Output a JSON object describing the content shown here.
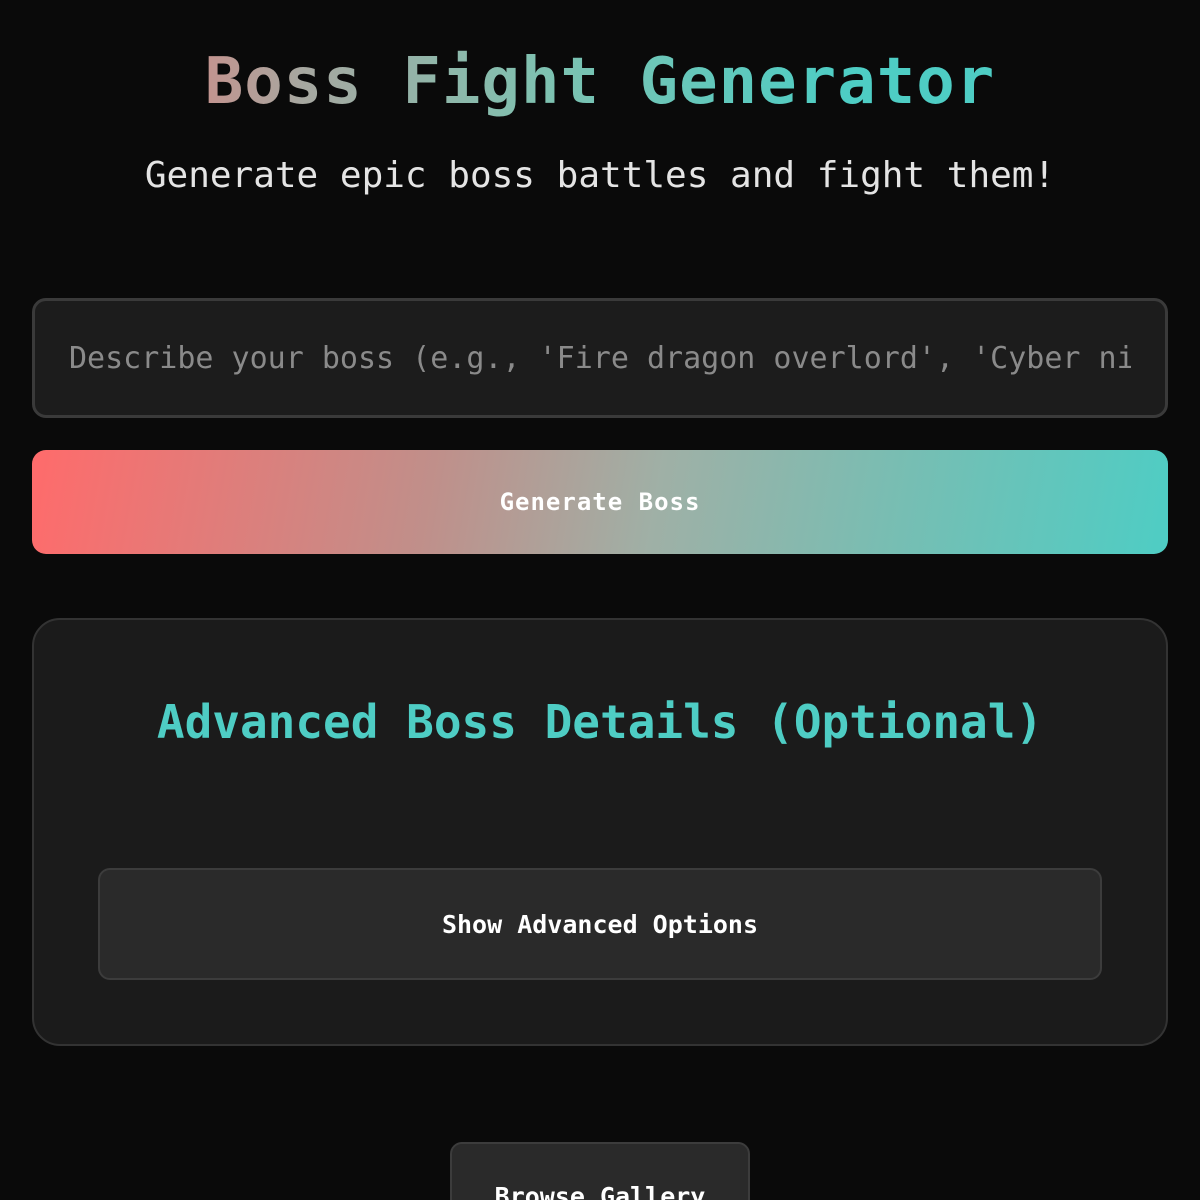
{
  "header": {
    "title": "Boss Fight Generator",
    "subtitle": "Generate epic boss battles and fight them!"
  },
  "boss_form": {
    "input_value": "",
    "input_placeholder": "Describe your boss (e.g., 'Fire dragon overlord', 'Cyber ninja assassin')",
    "generate_label": "Generate Boss"
  },
  "advanced": {
    "title": "Advanced Boss Details (Optional)",
    "toggle_label": "Show Advanced Options"
  },
  "footer": {
    "gallery_label": "Browse Gallery"
  },
  "colors": {
    "background": "#0a0a0a",
    "accent_red": "#ff6b6b",
    "accent_teal": "#4ecdc4",
    "card_background": "#1b1b1b"
  }
}
